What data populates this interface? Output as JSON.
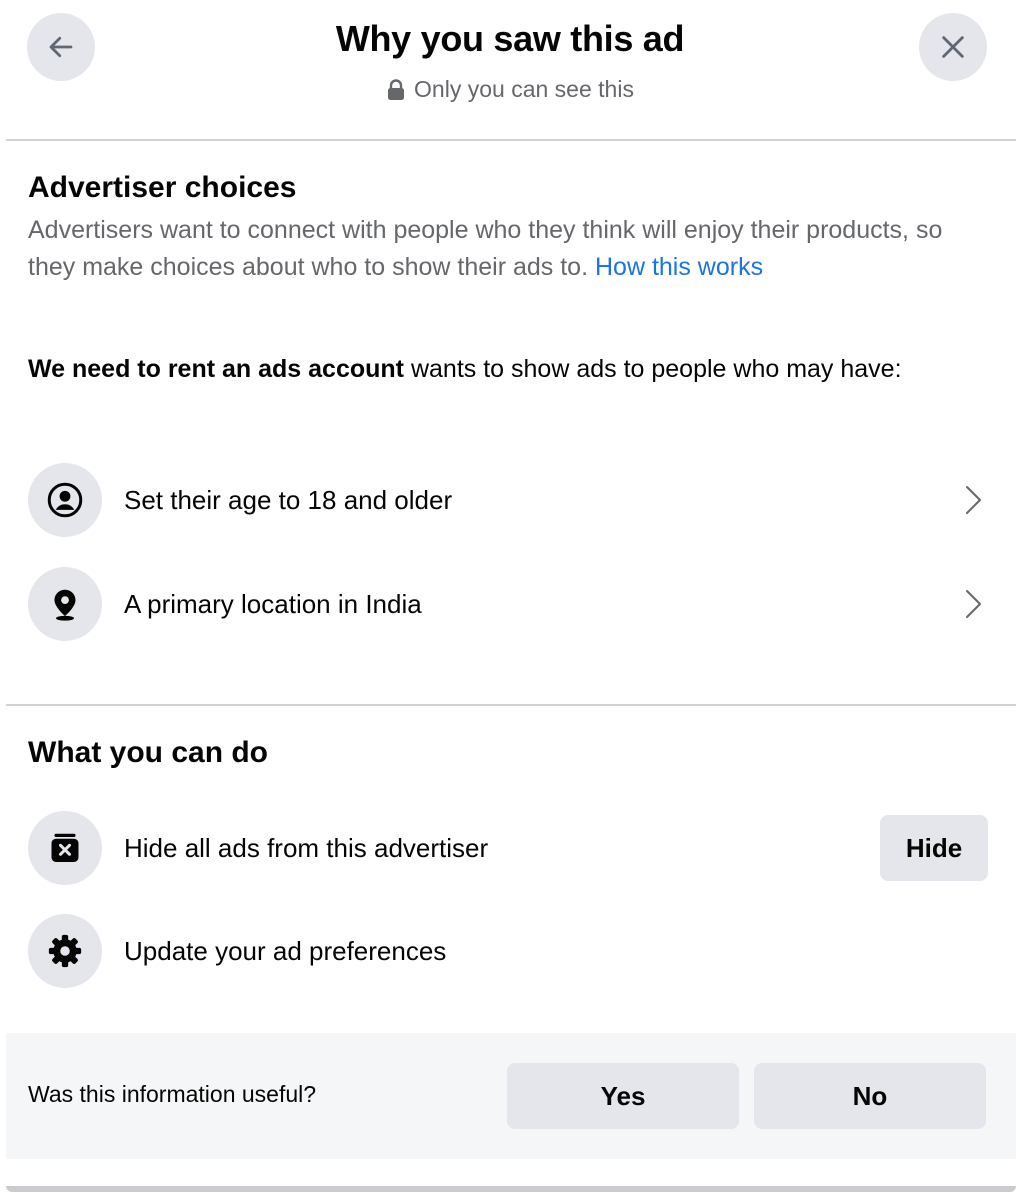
{
  "header": {
    "title": "Why you saw this ad",
    "subtitle": "Only you can see this",
    "back_icon": "arrow-left-icon",
    "close_icon": "close-icon",
    "lock_icon": "lock-icon"
  },
  "advertiser_choices": {
    "title": "Advertiser choices",
    "description": "Advertisers want to connect with people who they think will enjoy their products, so they make choices about who to show their ads to.",
    "link_label": "How this works",
    "advertiser_name": "We need to rent an ads account",
    "targeting_intro": "wants to show ads to people who may have:",
    "items": [
      {
        "label": "Set their age to 18 and older",
        "icon": "person-circle-icon"
      },
      {
        "label": "A primary location in India",
        "icon": "location-pin-icon"
      }
    ]
  },
  "what_you_can_do": {
    "title": "What you can do",
    "items": [
      {
        "label": "Hide all ads from this advertiser",
        "icon": "hide-ad-icon",
        "button_label": "Hide"
      },
      {
        "label": "Update your ad preferences",
        "icon": "gear-icon"
      }
    ]
  },
  "feedback": {
    "question": "Was this information useful?",
    "yes_label": "Yes",
    "no_label": "No"
  },
  "colors": {
    "link": "#1b74e4",
    "button_bg": "#e4e6eb",
    "muted_text": "#65676b",
    "footer_bg": "#f5f6f7"
  }
}
